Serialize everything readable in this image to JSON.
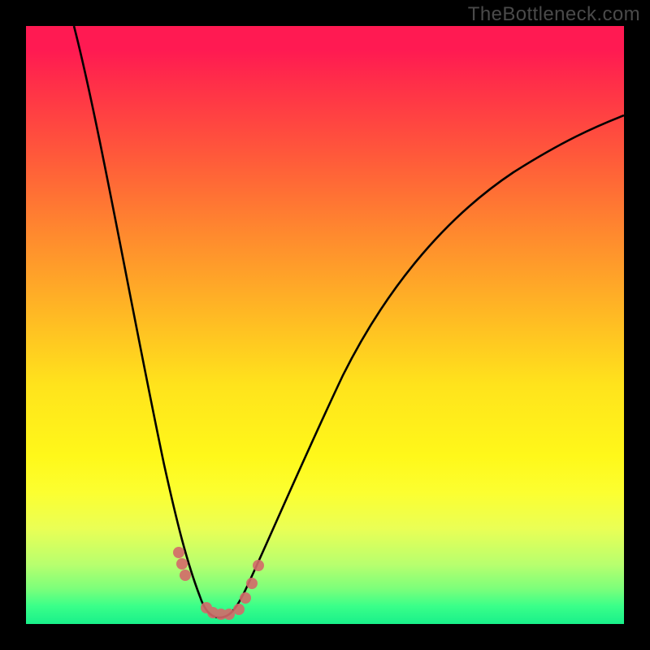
{
  "watermark": "TheBottleneck.com",
  "chart_data": {
    "type": "line",
    "title": "",
    "xlabel": "",
    "ylabel": "",
    "xlim": [
      0,
      100
    ],
    "ylim": [
      0,
      100
    ],
    "grid": false,
    "legend": false,
    "series": [
      {
        "name": "bottleneck-curve",
        "color": "#000000",
        "x": [
          8,
          12,
          16,
          20,
          24,
          26,
          28,
          30,
          32,
          34,
          36,
          40,
          46,
          54,
          62,
          70,
          80,
          90,
          100
        ],
        "y": [
          100,
          80,
          60,
          42,
          26,
          18,
          12,
          6,
          3,
          2,
          4,
          10,
          22,
          38,
          52,
          62,
          72,
          78,
          82
        ]
      },
      {
        "name": "highlight-markers",
        "color": "#d46a6a",
        "type": "scatter",
        "x": [
          25.5,
          26.0,
          26.5,
          30.0,
          31.0,
          32.5,
          34.0,
          35.5,
          36.5,
          37.5,
          38.5
        ],
        "y": [
          12,
          10,
          9,
          3,
          2,
          2,
          2,
          3,
          5,
          8,
          11
        ]
      }
    ],
    "background_gradient": {
      "orientation": "vertical",
      "stops": [
        {
          "pos": 0.0,
          "color": "#ff1a52"
        },
        {
          "pos": 0.22,
          "color": "#ff5a3a"
        },
        {
          "pos": 0.48,
          "color": "#ffb824"
        },
        {
          "pos": 0.72,
          "color": "#fff81a"
        },
        {
          "pos": 0.9,
          "color": "#b8ff6e"
        },
        {
          "pos": 1.0,
          "color": "#19f08a"
        }
      ]
    }
  }
}
